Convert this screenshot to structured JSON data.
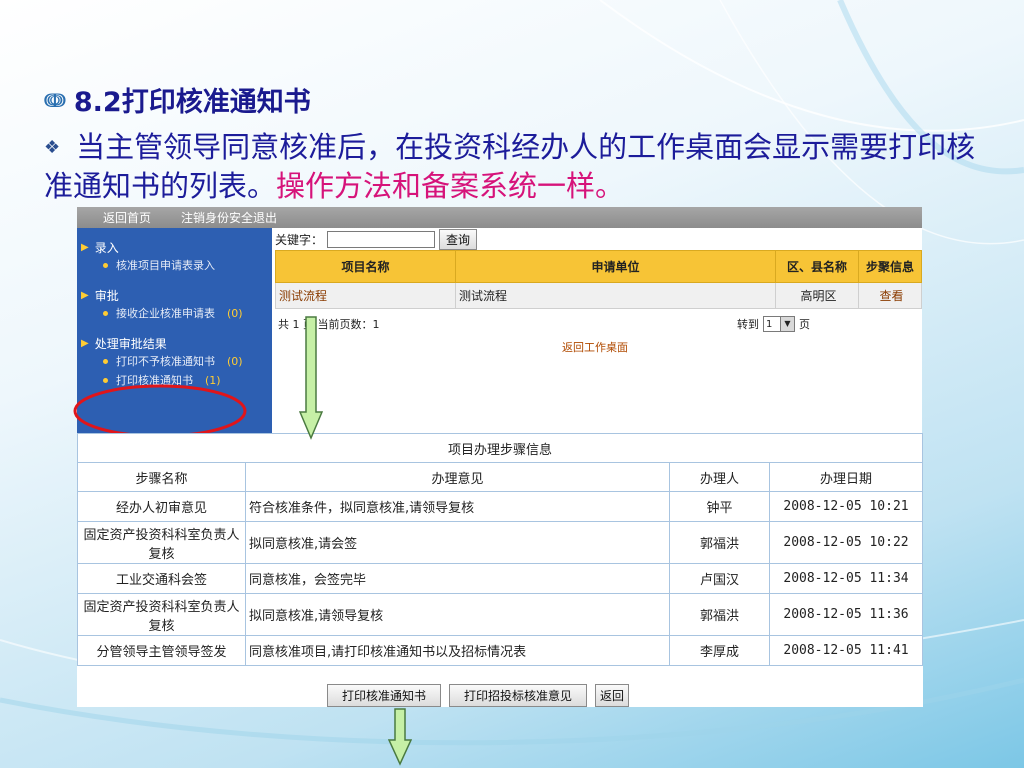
{
  "slide": {
    "heading": "8.2打印核准通知书",
    "heading_bullet": "ↈ",
    "para_bullet": "❖",
    "para_main": "当主管领导同意核准后，在投资科经办人的工作桌面会显示需要打印核准通知书的列表。",
    "para_pink": "操作方法和备案系统一样。"
  },
  "topbar": {
    "home": "返回首页",
    "logout": "注销身份安全退出"
  },
  "sidebar": {
    "groups": [
      {
        "label": "录入",
        "items": [
          {
            "label": "核准项目申请表录入",
            "count": ""
          }
        ]
      },
      {
        "label": "审批",
        "items": [
          {
            "label": "接收企业核准申请表",
            "count": "(0)"
          }
        ]
      },
      {
        "label": "处理审批结果",
        "items": [
          {
            "label": "打印不予核准通知书",
            "count": "(0)"
          },
          {
            "label": "打印核准通知书",
            "count": "(1)"
          }
        ]
      }
    ]
  },
  "search": {
    "label": "关键字：",
    "value": "",
    "button": "查询"
  },
  "list_table": {
    "headers": [
      "项目名称",
      "申请单位",
      "区、县名称",
      "步聚信息"
    ],
    "rows": [
      [
        "测试流程",
        "测试流程",
        "高明区",
        "查看"
      ]
    ]
  },
  "pager": {
    "summary": "共 1 页 当前页数：1",
    "goto_label": "转到",
    "goto_value": "1",
    "page_unit": "页",
    "back_link": "返回工作桌面"
  },
  "steps_table": {
    "title": "项目办理步骤信息",
    "headers": [
      "步骤名称",
      "办理意见",
      "办理人",
      "办理日期"
    ],
    "rows": [
      [
        "经办人初审意见",
        "符合核准条件，拟同意核准,请领导复核",
        "钟平",
        "2008-12-05 10:21"
      ],
      [
        "固定资产投资科科室负责人复核",
        "拟同意核准,请会签",
        "郭福洪",
        "2008-12-05 10:22"
      ],
      [
        "工业交通科会签",
        "同意核准，会签完毕",
        "卢国汉",
        "2008-12-05 11:34"
      ],
      [
        "固定资产投资科科室负责人复核",
        "拟同意核准,请领导复核",
        "郭福洪",
        "2008-12-05 11:36"
      ],
      [
        "分管领导主管领导签发",
        "同意核准项目,请打印核准通知书以及招标情况表",
        "李厚成",
        "2008-12-05 11:41"
      ]
    ]
  },
  "bottom_buttons": {
    "print_notice": "打印核准通知书",
    "print_tender": "打印招投标核准意见",
    "back": "返回"
  },
  "colors": {
    "title_blue": "#1a1a8e",
    "pink": "#d6137a",
    "sidebar_blue": "#2d5fb2",
    "header_gold": "#f7c436",
    "arrow_green": "#c6f0a6"
  }
}
